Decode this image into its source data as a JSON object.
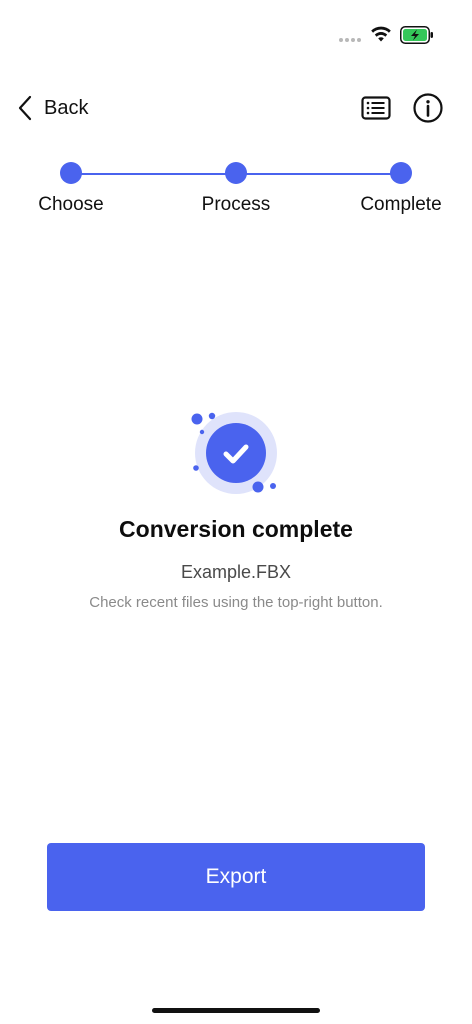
{
  "status_bar": {
    "icons": [
      "cellular-signal-icon",
      "wifi-icon",
      "battery-charging-icon"
    ]
  },
  "nav": {
    "back_label": "Back",
    "icons": {
      "back": "chevron-left-icon",
      "recent_files": "list-icon",
      "info": "info-icon"
    }
  },
  "stepper": {
    "steps": [
      {
        "label": "Choose"
      },
      {
        "label": "Process"
      },
      {
        "label": "Complete"
      }
    ],
    "current_step": 3
  },
  "result": {
    "icon": "check-circle-icon",
    "title": "Conversion complete",
    "filename": "Example.FBX",
    "hint": "Check recent files using the top-right button."
  },
  "actions": {
    "export_label": "Export"
  },
  "colors": {
    "accent": "#4a63ee",
    "accent_light": "#dfe3fb",
    "battery": "#34c759",
    "text_primary": "#111111",
    "text_secondary": "#4a4a4a",
    "text_muted": "#8a8a8a"
  }
}
